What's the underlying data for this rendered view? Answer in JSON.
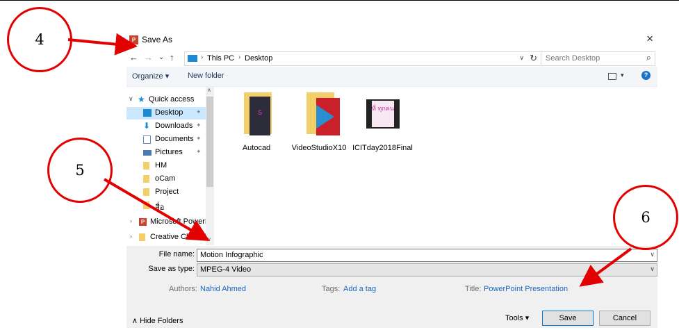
{
  "dialog": {
    "title": "Save As",
    "close_glyph": "×",
    "app_icon_text": "P"
  },
  "nav": {
    "back": "←",
    "forward": "→",
    "recent": "⌄",
    "up": "↑",
    "breadcrumb": [
      "This PC",
      "Desktop"
    ],
    "sep": "›",
    "search_placeholder": "Search Desktop",
    "search_icon": "⌕",
    "refresh": "↻",
    "dropdown": "∨"
  },
  "toolbar": {
    "organize": "Organize ▾",
    "new_folder": "New folder",
    "view_dd": "▾",
    "help": "?"
  },
  "tree": {
    "quick_access": "Quick access",
    "items": [
      {
        "label": "Desktop"
      },
      {
        "label": "Downloads"
      },
      {
        "label": "Documents"
      },
      {
        "label": "Pictures"
      },
      {
        "label": "HM"
      },
      {
        "label": "oCam"
      },
      {
        "label": "Project"
      },
      {
        "label": "สื่อ"
      },
      {
        "label": "Microsoft PowerP"
      },
      {
        "label": "Creative Cloud Fil"
      }
    ],
    "pin": "📌"
  },
  "files": [
    {
      "label": "Autocad"
    },
    {
      "label": "VideoStudioX10"
    },
    {
      "label": "ICITday2018Final"
    }
  ],
  "video_thumb_text": "ที่ ทุกคน",
  "save_panel": {
    "file_name_label": "File name:",
    "file_name_value": "Motion Infographic",
    "save_type_label": "Save as type:",
    "save_type_value": "MPEG-4 Video",
    "authors_label": "Authors:",
    "authors_value": "Nahid Ahmed",
    "tags_label": "Tags:",
    "tags_value": "Add a tag",
    "title_label": "Title:",
    "title_value": "PowerPoint Presentation",
    "hide_folders": "Hide Folders",
    "tools": "Tools",
    "save": "Save",
    "cancel": "Cancel"
  },
  "annotations": [
    "4",
    "5",
    "6"
  ],
  "colors": {
    "annotation": "#e30000",
    "accent": "#0078d7",
    "link": "#1a66c1"
  }
}
